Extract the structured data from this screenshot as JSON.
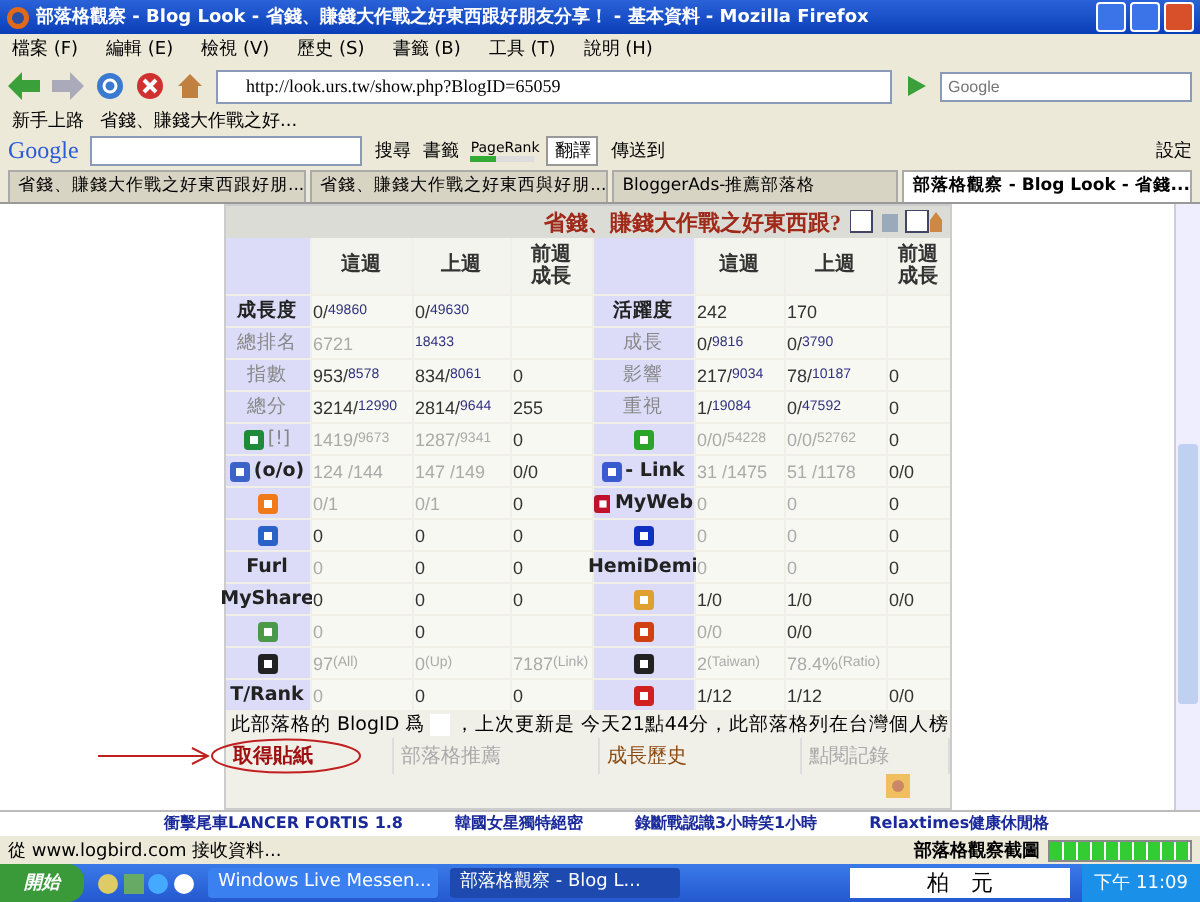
{
  "window": {
    "title": "部落格觀察 - Blog Look - 省錢、賺錢大作戰之好東西跟好朋友分享！ - 基本資料 - Mozilla Firefox"
  },
  "menu": [
    "檔案 (F)",
    "編輯 (E)",
    "檢視 (V)",
    "歷史 (S)",
    "書籤 (B)",
    "工具 (T)",
    "說明 (H)"
  ],
  "address": {
    "value": "http://look.urs.tw/show.php?BlogID=65059"
  },
  "search": {
    "placeholder": "Google"
  },
  "bookmarks": [
    "新手上路",
    "省錢、賺錢大作戰之好..."
  ],
  "google_toolbar": {
    "logo": "Google",
    "search_label": "搜尋",
    "bookmarks_label": "書籤",
    "pagerank": {
      "label": "PageRank",
      "level": 0.4
    },
    "translate_label": "翻譯",
    "send_label": "傳送到",
    "settings_label": "設定"
  },
  "tabs": [
    {
      "label": "省錢、賺錢大作戰之好東西跟好朋...",
      "selected": false
    },
    {
      "label": "省錢、賺錢大作戰之好東西與好朋...",
      "selected": false
    },
    {
      "label": "BloggerAds-推薦部落格",
      "selected": false
    },
    {
      "label": "部落格觀察 - Blog Look - 省錢...",
      "selected": true
    }
  ],
  "page": {
    "heading": "省錢、賺錢大作戰之好東西跟?",
    "left_columns": [
      "這週",
      "上週",
      "前週成長"
    ],
    "right_columns": [
      "這週",
      "上週",
      "前週成長"
    ],
    "rows": [
      {
        "left": {
          "label": {
            "text": "成長度",
            "muted": false
          },
          "this": {
            "value": "0/",
            "total": "49860",
            "muted": false
          },
          "last": {
            "value": "0/",
            "total": "49630",
            "muted": false
          }
        },
        "right": {
          "label": {
            "text": "活躍度",
            "muted": false
          },
          "this": {
            "value": "242",
            "muted": false
          },
          "last": {
            "value": "170",
            "muted": false
          }
        }
      },
      {
        "left": {
          "label": {
            "text": "總排名",
            "muted": true
          },
          "this": {
            "value": "6721",
            "muted": true
          },
          "last": {
            "total": "18433",
            "muted": false
          }
        },
        "right": {
          "label": {
            "text": "成長",
            "muted": true
          },
          "this": {
            "value": "0/",
            "total": "9816",
            "muted": false
          },
          "last": {
            "value": "0/",
            "total": "3790",
            "muted": false
          }
        }
      },
      {
        "left": {
          "label": {
            "text": "指數",
            "muted": true
          },
          "this": {
            "value": "953/",
            "total": "8578",
            "muted": false
          },
          "last": {
            "value": "834/",
            "total": "8061",
            "muted": false
          },
          "growth": "0"
        },
        "right": {
          "label": {
            "text": "影響",
            "muted": true
          },
          "this": {
            "value": "217/",
            "total": "9034",
            "muted": false
          },
          "last": {
            "value": "78/",
            "total": "10187",
            "muted": false
          },
          "growth": "0"
        }
      },
      {
        "left": {
          "label": {
            "text": "總分",
            "muted": true
          },
          "this": {
            "value": "3214/",
            "total": "12990",
            "muted": false
          },
          "last": {
            "value": "2814/",
            "total": "9644",
            "muted": false
          },
          "growth": "255"
        },
        "right": {
          "label": {
            "text": "重視",
            "muted": true
          },
          "this": {
            "value": "1/",
            "total": "19084",
            "muted": false
          },
          "last": {
            "value": "0/",
            "total": "47592",
            "muted": false
          },
          "growth": "0"
        }
      },
      {
        "left": {
          "label": {
            "text": "[!]",
            "muted": true
          },
          "this": {
            "value": "1419/",
            "total": "9673",
            "muted": true
          },
          "last": {
            "value": "1287/",
            "total": "9341",
            "muted": true
          },
          "growth": "0"
        },
        "right": {
          "this": {
            "value": "0/0/",
            "total": "54228",
            "muted": true
          },
          "last": {
            "value": "0/0/",
            "total": "52762",
            "muted": true
          },
          "growth": "0"
        }
      },
      {
        "left": {
          "label": {
            "text": "(o/o)",
            "muted": false
          },
          "this": {
            "value": "124 /144",
            "muted": true
          },
          "last": {
            "value": "147 /149",
            "muted": true
          },
          "growth": "0/0"
        },
        "right": {
          "label": {
            "text": "- Link",
            "muted": false
          },
          "this": {
            "value": "31 /1475",
            "muted": true
          },
          "last": {
            "value": "51 /1178",
            "muted": true
          },
          "growth": "0/0"
        }
      },
      {
        "left": {
          "this": {
            "value": "0/1",
            "muted": true
          },
          "last": {
            "value": "0/1",
            "muted": true
          },
          "growth": "0"
        },
        "right": {
          "label": {
            "text": "MyWeb",
            "muted": false
          },
          "this": {
            "value": "0",
            "muted": true
          },
          "last": {
            "value": "0",
            "muted": true
          },
          "growth": "0"
        }
      },
      {
        "left": {
          "this": {
            "value": "0",
            "muted": false
          },
          "last": {
            "value": "0",
            "muted": false
          },
          "growth": "0"
        },
        "right": {
          "this": {
            "value": "0",
            "muted": true
          },
          "last": {
            "value": "0",
            "muted": true
          },
          "growth": "0"
        }
      },
      {
        "left": {
          "label": {
            "text": "Furl",
            "muted": false
          },
          "this": {
            "value": "0",
            "muted": true
          },
          "last": {
            "value": "0",
            "muted": false
          },
          "growth": "0"
        },
        "right": {
          "label": {
            "text": "HemiDemi",
            "muted": false
          },
          "this": {
            "value": "0",
            "muted": true
          },
          "last": {
            "value": "0",
            "muted": true
          },
          "growth": "0"
        }
      },
      {
        "left": {
          "label": {
            "text": "MyShare",
            "muted": false
          },
          "this": {
            "value": "0",
            "muted": false
          },
          "last": {
            "value": "0",
            "muted": false
          },
          "growth": "0"
        },
        "right": {
          "this": {
            "value": "1/0",
            "muted": false
          },
          "last": {
            "value": "1/0",
            "muted": false
          },
          "growth": "0/0"
        }
      },
      {
        "left": {
          "this": {
            "value": "0",
            "muted": true
          },
          "last": {
            "value": "0",
            "muted": false
          }
        },
        "right": {
          "this": {
            "value": "0/0",
            "muted": true
          },
          "last": {
            "value": "0/0",
            "muted": false
          }
        }
      },
      {
        "left": {
          "this": {
            "value": "97",
            "total": "(All)",
            "muted": true
          },
          "last": {
            "value": "0",
            "total": "(Up)",
            "muted": true
          },
          "growth_detail": {
            "value": "7187",
            "total": "(Link)",
            "muted": true
          }
        },
        "right": {
          "this": {
            "value": "2",
            "total": "(Taiwan)",
            "muted": true
          },
          "last": {
            "value": "78.4%",
            "total": "(Ratio)",
            "muted": true
          }
        }
      },
      {
        "left": {
          "label": {
            "text": "T/Rank",
            "muted": false
          },
          "this": {
            "value": "0",
            "muted": true
          },
          "last": {
            "value": "0",
            "muted": false
          },
          "growth": "0"
        },
        "right": {
          "this": {
            "value": "1/12",
            "muted": false
          },
          "last": {
            "value": "1/12",
            "muted": false
          },
          "growth": "0/0"
        }
      }
    ],
    "note_before": "此部落格的 BlogID 爲",
    "note_after": "，上次更新是 今天21點44分，此部落格列在台灣個人榜",
    "links": [
      {
        "label": "取得貼紙",
        "kind": "sticker"
      },
      {
        "label": "部落格推薦",
        "kind": "muted"
      },
      {
        "label": "成長歷史",
        "kind": "history"
      },
      {
        "label": "點閱記錄",
        "kind": "muted"
      }
    ],
    "ad_links": [
      "衝擊尾車LANCER FORTIS 1.8",
      "韓國女星獨特絕密",
      "錄斷戰認識3小時笑1小時",
      "Relaxtimes健康休閒格"
    ]
  },
  "status_bar": {
    "text": "從 www.logbird.com 接收資料...",
    "addon_label": "部落格觀察截圖",
    "progress": {
      "level": 1
    }
  },
  "taskbar": {
    "start_label": "開始",
    "windows": [
      {
        "label": "Windows Live Messen...",
        "selected": false
      },
      {
        "label": "部落格觀察 - Blog L...",
        "selected": true
      }
    ],
    "ime_text": "柏　元",
    "clock": "下午 11:09"
  }
}
